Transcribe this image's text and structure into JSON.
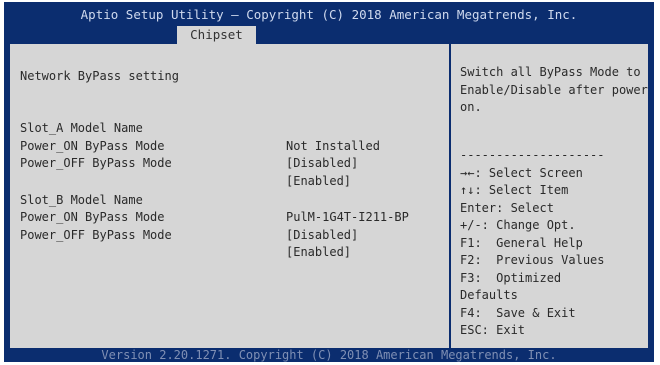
{
  "header": {
    "title": "Aptio Setup Utility – Copyright (C) 2018 American Megatrends, Inc.",
    "active_tab": "Chipset"
  },
  "main": {
    "section_title": "Network ByPass setting",
    "slot_a": {
      "model_label": "Slot_A Model Name",
      "model_value": "Not Installed",
      "power_on_label": "Power_ON ByPass Mode",
      "power_on_value": "[Disabled]",
      "power_off_label": "Power_OFF ByPass Mode",
      "power_off_value": "[Enabled]"
    },
    "slot_b": {
      "model_label": "Slot_B Model Name",
      "model_value": "PulM-1G4T-I211-BP",
      "power_on_label": "Power_ON ByPass Mode",
      "power_on_value": "[Disabled]",
      "power_off_label": "Power_OFF ByPass Mode",
      "power_off_value": "[Enabled]"
    }
  },
  "help": {
    "text": "Switch all ByPass Mode to Enable/Disable after power on.",
    "separator": "--------------------",
    "keys": [
      "→←: Select Screen",
      "↑↓: Select Item",
      "Enter: Select",
      "+/-: Change Opt.",
      "F1:  General Help",
      "F2:  Previous Values",
      "F3:  Optimized",
      "Defaults",
      "F4:  Save & Exit",
      "ESC: Exit"
    ]
  },
  "footer": {
    "text": "Version 2.20.1271. Copyright (C) 2018 American Megatrends, Inc."
  },
  "colors": {
    "frame": "#0b2d6f",
    "panel": "#d6d6d6",
    "header_text": "#cfd9ee",
    "footer_text": "#7f8fb4"
  }
}
